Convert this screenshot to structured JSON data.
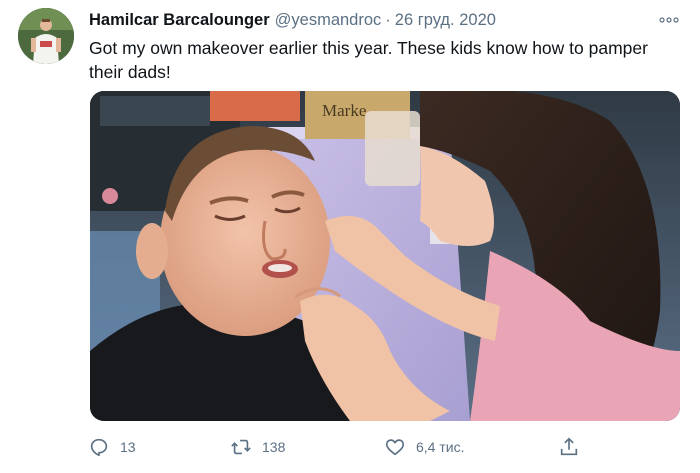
{
  "tweet": {
    "author_name": "Hamilcar Barcalounger",
    "author_handle": "@yesmandroc",
    "separator": "·",
    "date": "26 груд. 2020",
    "text": "Got my own makeover earlier this year. These kids know how to pamper\ntheir dads!",
    "media": {
      "box_label_text": "Marke"
    }
  },
  "actions": {
    "reply_count": "13",
    "retweet_count": "138",
    "like_count": "6,4 тис."
  },
  "icons": {
    "avatar": "avatar",
    "more": "more-icon",
    "reply": "reply-icon",
    "retweet": "retweet-icon",
    "like": "like-icon",
    "share": "share-icon"
  },
  "colors": {
    "text_primary": "#0f1419",
    "text_secondary": "#5b7083",
    "background": "#ffffff"
  }
}
